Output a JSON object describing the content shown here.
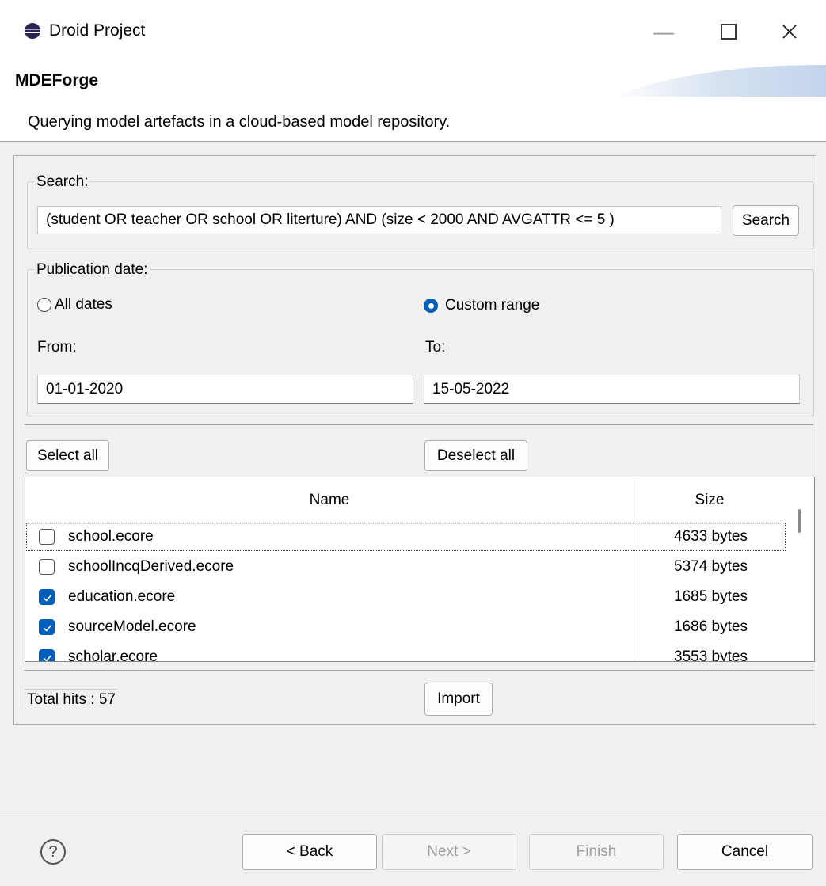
{
  "window": {
    "title": "Droid Project",
    "minimize_icon": "minimize-icon",
    "maximize_icon": "maximize-icon",
    "close_icon": "close-icon"
  },
  "header": {
    "title": "MDEForge",
    "description": "Querying model artefacts in a cloud-based model repository."
  },
  "search": {
    "group_label": "Search:",
    "query": "(student OR teacher OR school OR literture) AND (size < 2000 AND AVGATTR <= 5 )",
    "button_label": "Search"
  },
  "publication": {
    "group_label": "Publication date:",
    "all_dates_label": "All dates",
    "custom_range_label": "Custom range",
    "selected": "custom",
    "from_label": "From:",
    "from_value": "01-01-2020",
    "to_label": "To:",
    "to_value": "15-05-2022"
  },
  "selection": {
    "select_all_label": "Select all",
    "deselect_all_label": "Deselect all"
  },
  "table": {
    "columns": [
      "Name",
      "Size"
    ],
    "rows": [
      {
        "name": "school.ecore",
        "size": "4633 bytes",
        "checked": false
      },
      {
        "name": "schoolIncqDerived.ecore",
        "size": "5374 bytes",
        "checked": false
      },
      {
        "name": "education.ecore",
        "size": "1685 bytes",
        "checked": true
      },
      {
        "name": "sourceModel.ecore",
        "size": "1686 bytes",
        "checked": true
      },
      {
        "name": "scholar.ecore",
        "size": "3553 bytes",
        "checked": true
      }
    ]
  },
  "status": {
    "total_hits": "Total hits : 57",
    "import_label": "Import"
  },
  "footer": {
    "help_icon": "help-icon",
    "back_label": "< Back",
    "next_label": "Next >",
    "finish_label": "Finish",
    "cancel_label": "Cancel"
  },
  "colors": {
    "accent": "#005fb8",
    "content_bg": "#f0f0f0",
    "disabled_text": "#a0a0a0"
  }
}
